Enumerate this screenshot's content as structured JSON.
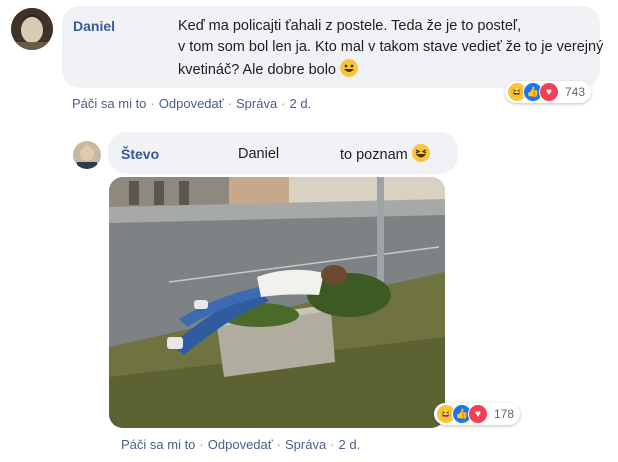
{
  "comments": [
    {
      "author": "Daniel",
      "text_lines": [
        "Keď ma policajti ťahali z postele. Teda že je to posteľ,",
        "v tom som bol len ja. Kto mal v takom stave vedieť že to je verejný",
        "kvetináč? Ale dobre bolo"
      ],
      "emoji": "grinning-face-emoji",
      "reaction_count": "743",
      "actions": {
        "like": "Páči sa mi to",
        "reply": "Odpovedať",
        "message": "Správa",
        "time": "2 d."
      }
    },
    {
      "author": "Števo",
      "mention": "Daniel",
      "text": "to poznam",
      "emoji": "grinning-squinting-emoji",
      "reaction_count": "178",
      "image": "photo-man-sleeping-on-street-planter",
      "actions": {
        "like": "Páči sa mi to",
        "reply": "Odpovedať",
        "message": "Správa",
        "time": "2 d."
      }
    }
  ],
  "colors": {
    "author": "#385898",
    "bubble": "#f0f2f5",
    "link": "#4b5e8a",
    "haha": "#f7c63b",
    "like": "#1877f2",
    "love": "#f33e58"
  }
}
